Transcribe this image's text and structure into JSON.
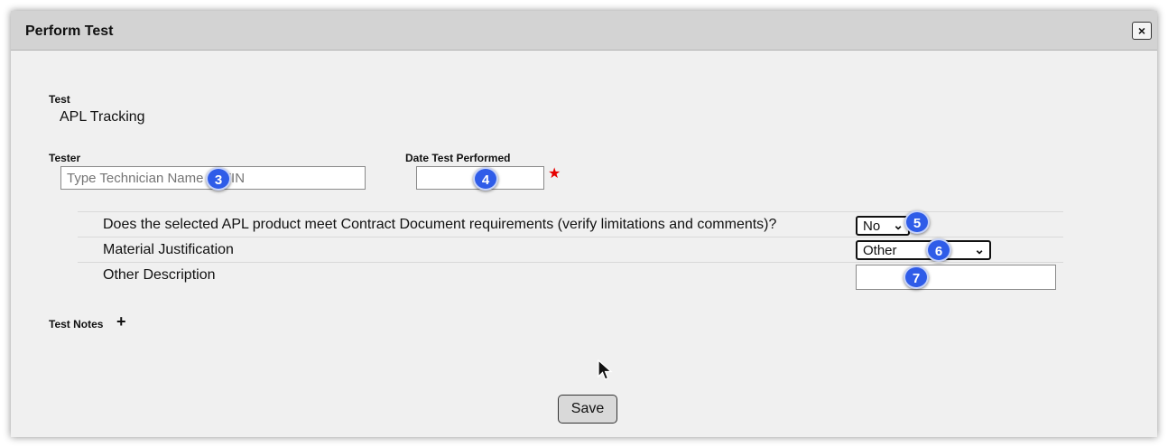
{
  "dialog": {
    "title": "Perform Test",
    "close_glyph": "×"
  },
  "test": {
    "label": "Test",
    "value": "APL Tracking"
  },
  "tester": {
    "label": "Tester",
    "placeholder": "Type Technician Name or TIN",
    "value": ""
  },
  "date": {
    "label": "Date Test Performed",
    "value": "",
    "required_mark": "★"
  },
  "questions": [
    {
      "text": "Does the selected APL product meet Contract Document requirements (verify limitations and comments)?",
      "selected": "No"
    },
    {
      "text": "Material Justification",
      "selected": "Other"
    },
    {
      "text": "Other Description",
      "value": ""
    }
  ],
  "notes": {
    "label": "Test Notes",
    "add_glyph": "+"
  },
  "save": {
    "label": "Save"
  },
  "step_badges": [
    "3",
    "4",
    "5",
    "6",
    "7"
  ],
  "icons": {
    "chevron": "⌄",
    "close": "close-icon",
    "cursor": "mouse-pointer-icon"
  }
}
